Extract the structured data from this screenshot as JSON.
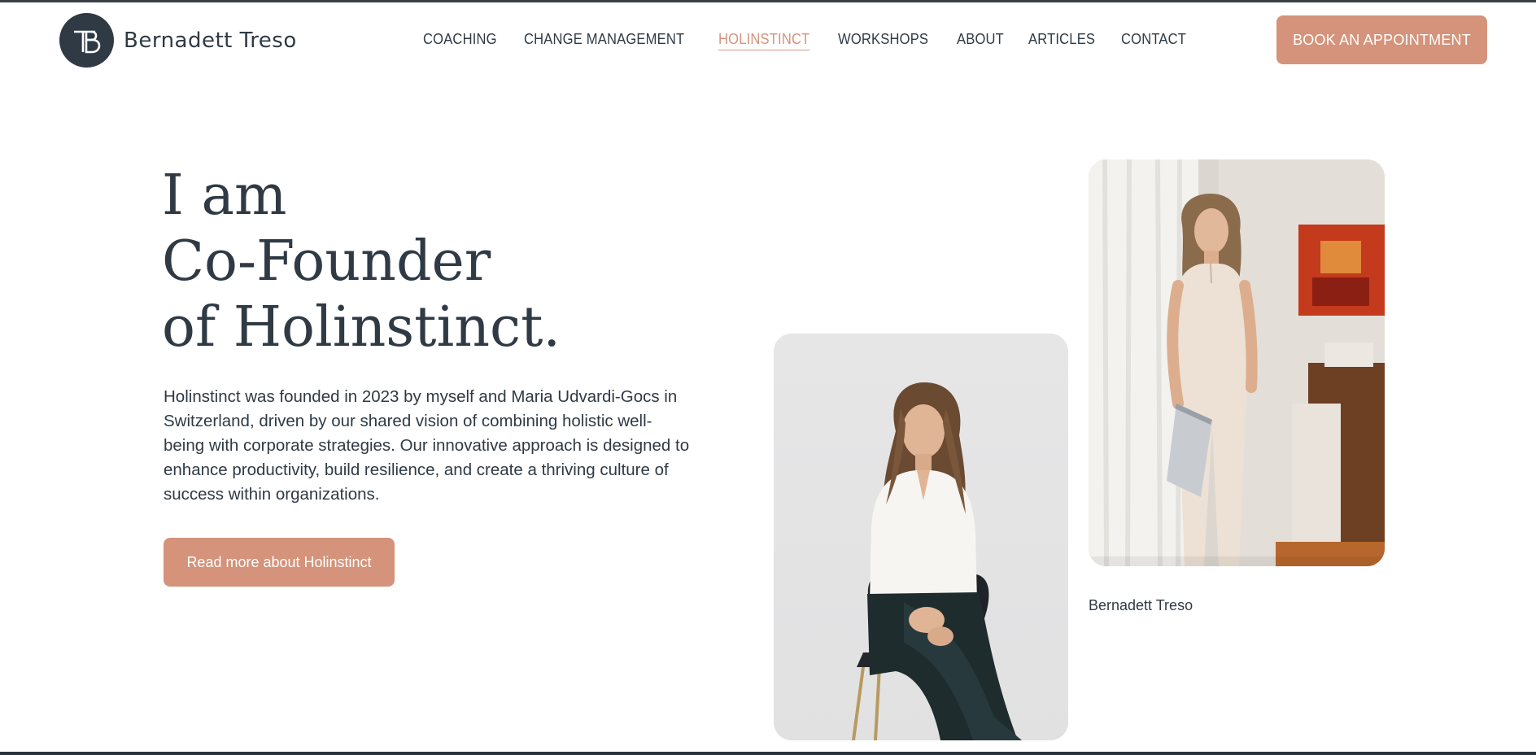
{
  "header": {
    "logo_text": "Bernadett Treso",
    "nav": [
      {
        "label": "COACHING",
        "active": false
      },
      {
        "label": "CHANGE MANAGEMENT",
        "active": false
      },
      {
        "label": "HOLINSTINCT",
        "active": true
      },
      {
        "label": "WORKSHOPS",
        "active": false
      },
      {
        "label": "ABOUT",
        "active": false
      },
      {
        "label": "ARTICLES",
        "active": false
      },
      {
        "label": "CONTACT",
        "active": false
      }
    ],
    "cta_label": "BOOK AN APPOINTMENT"
  },
  "hero": {
    "title_lines": [
      "I am",
      "Co-Founder",
      "of Holinstinct."
    ],
    "body": "Holinstinct was founded in 2023 by myself and Maria Udvardi-Gocs in Switzerland, driven by our shared vision of combining holistic well-being with corporate strategies. Our innovative approach is designed to enhance productivity, build resilience, and create a thriving culture of success within organizations.",
    "button_label": "Read more about Holinstinct"
  },
  "photos": {
    "caption": "Bernadett Treso"
  },
  "colors": {
    "accent": "#d4937a",
    "text": "#2f3a45",
    "background": "#ffffff"
  }
}
